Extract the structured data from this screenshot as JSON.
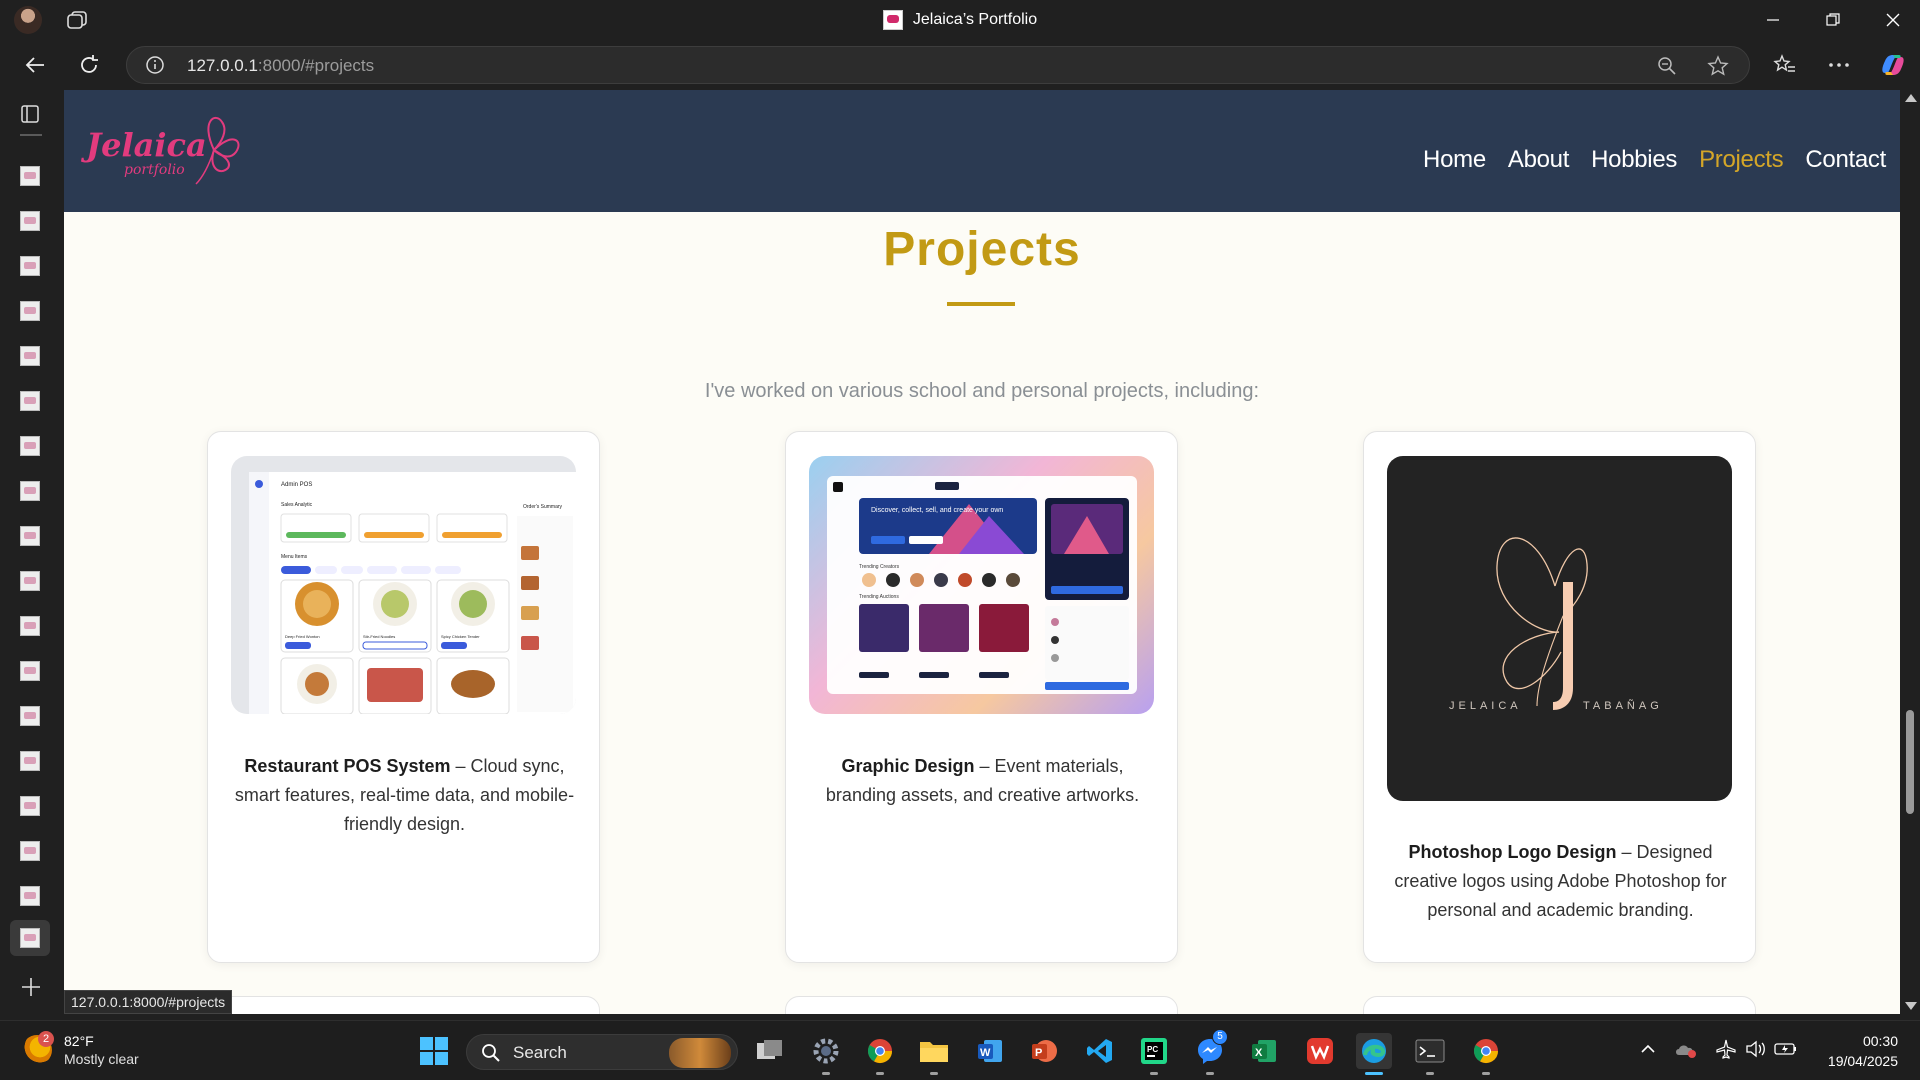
{
  "browser": {
    "window_title": "Jelaica’s Portfolio",
    "url_host": "127.0.0.1",
    "url_rest": ":8000/#projects",
    "status_url": "127.0.0.1:8000/#projects"
  },
  "site": {
    "logo_text": "Jelaica",
    "logo_sub": "portfolio",
    "nav": [
      {
        "label": "Home"
      },
      {
        "label": "About"
      },
      {
        "label": "Hobbies"
      },
      {
        "label": "Projects",
        "active": true
      },
      {
        "label": "Contact"
      }
    ],
    "accent_color": "#c29a14",
    "header_color": "#2b3a52"
  },
  "projects": {
    "title": "Projects",
    "intro": "I've worked on various school and personal projects, including:",
    "cards": [
      {
        "name": "Restaurant POS System",
        "desc": " – Cloud sync, smart features, real-time data, and mobile-friendly design."
      },
      {
        "name": "Graphic Design",
        "desc": " – Event materials, branding assets, and creative artworks."
      },
      {
        "name": "Photoshop Logo Design",
        "desc": " – Designed creative logos using Adobe Photoshop for personal and academic branding."
      }
    ]
  },
  "pos_mock": {
    "app_title": "Admin POS",
    "sales_label": "Sales Analytic",
    "orders_label": "Order's Summary",
    "menu_label": "Menu Items",
    "items": [
      "Deep Fried Wonton",
      "Stir-Fried Noodles",
      "Spicy Chicken Tender"
    ]
  },
  "gd_mock": {
    "hero": "Discover, collect, sell, and create your own",
    "creators": "Trending Creators",
    "auctions": "Trending Auctions"
  },
  "logo_mock": {
    "name_left": "JELAICA",
    "name_right": "TABAÑAG"
  },
  "taskbar": {
    "weather_temp": "82°F",
    "weather_desc": "Mostly clear",
    "weather_badge": "2",
    "search": "Search",
    "messenger_badge": "5",
    "time": "00:30",
    "date": "19/04/2025"
  }
}
